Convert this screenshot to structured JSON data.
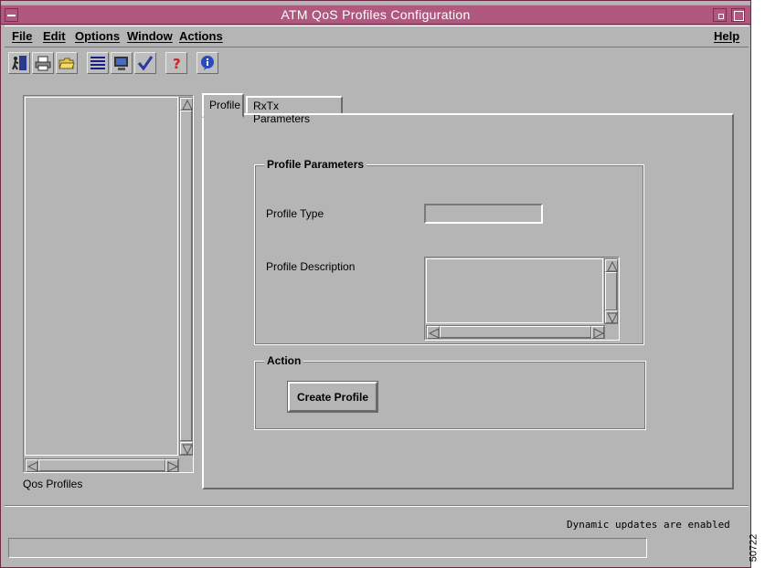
{
  "window": {
    "title": "ATM QoS Profiles Configuration"
  },
  "menu": {
    "file": "File",
    "edit": "Edit",
    "options": "Options",
    "window": "Window",
    "actions": "Actions",
    "help": "Help"
  },
  "toolbar": {
    "icons": [
      "exit-door-icon",
      "print-icon",
      "open-folder-icon",
      "list-view-icon",
      "monitor-icon",
      "checkmark-icon",
      "help-question-icon",
      "info-icon"
    ]
  },
  "list_panel": {
    "label": "Qos Profiles",
    "items": []
  },
  "tabs": {
    "profile": "Profile",
    "rxtx": "RxTx Parameters"
  },
  "profile_parameters": {
    "title": "Profile Parameters",
    "type_label": "Profile Type",
    "type_value": "",
    "description_label": "Profile Description",
    "description_value": ""
  },
  "action": {
    "title": "Action",
    "create_button": "Create Profile"
  },
  "status": {
    "message": "Dynamic updates are enabled",
    "bar_value": ""
  },
  "figure_id": "50722",
  "colors": {
    "titlebar": "#b0587e",
    "background": "#b5b5b5"
  }
}
